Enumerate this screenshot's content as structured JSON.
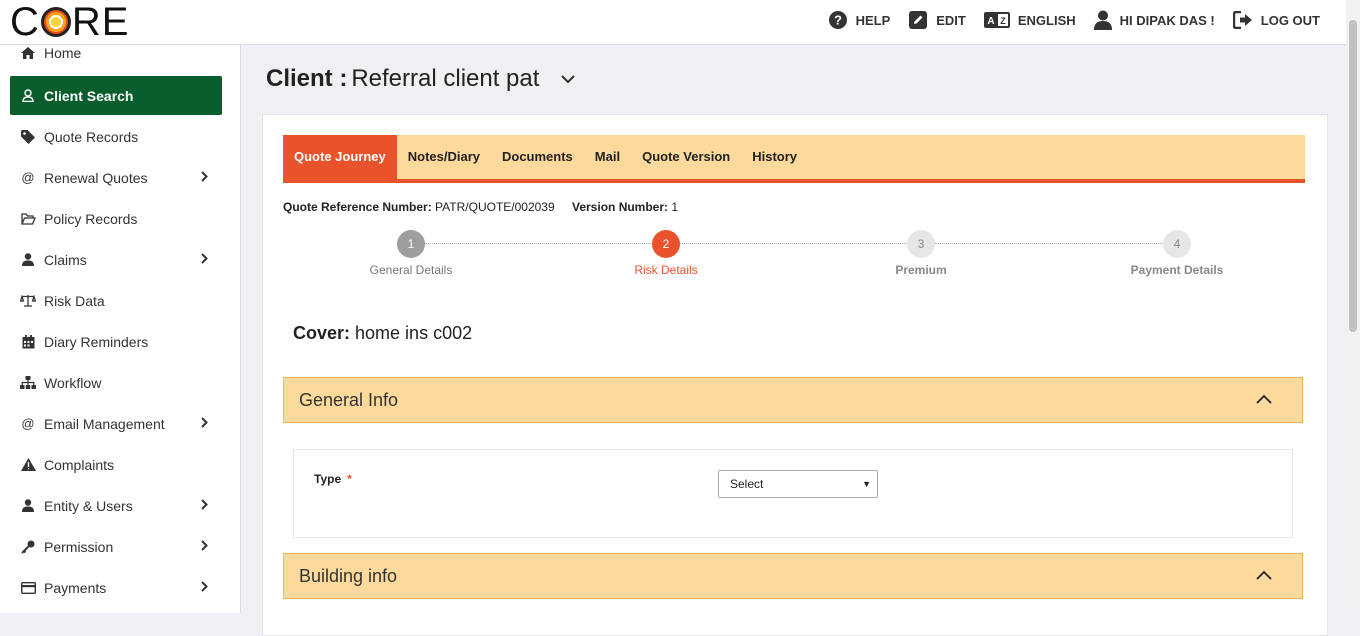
{
  "app": {
    "logo_text_left": "C",
    "logo_text_right": "RE",
    "logo_name": "CORE"
  },
  "topnav": {
    "help": "HELP",
    "edit": "EDIT",
    "language": "ENGLISH",
    "user": "HI DIPAK DAS !",
    "logout": "LOG OUT"
  },
  "sidebar": {
    "items": [
      {
        "label": "Home",
        "icon": "home-icon"
      },
      {
        "label": "Client Search",
        "icon": "user-icon",
        "active": true
      },
      {
        "label": "Quote Records",
        "icon": "tag-icon"
      },
      {
        "label": "Renewal Quotes",
        "icon": "at-icon",
        "has_submenu": true
      },
      {
        "label": "Policy Records",
        "icon": "folder-icon"
      },
      {
        "label": "Claims",
        "icon": "user-icon",
        "has_submenu": true
      },
      {
        "label": "Risk Data",
        "icon": "balance-scale-icon"
      },
      {
        "label": "Diary Reminders",
        "icon": "calendar-icon"
      },
      {
        "label": "Workflow",
        "icon": "sitemap-icon"
      },
      {
        "label": "Email Management",
        "icon": "at-icon",
        "has_submenu": true
      },
      {
        "label": "Complaints",
        "icon": "warning-icon"
      },
      {
        "label": "Entity & Users",
        "icon": "user-icon",
        "has_submenu": true
      },
      {
        "label": "Permission",
        "icon": "key-icon",
        "has_submenu": true
      },
      {
        "label": "Payments",
        "icon": "credit-card-icon",
        "has_submenu": true
      }
    ]
  },
  "header": {
    "client_prefix": "Client :",
    "client_name": "Referral client pat"
  },
  "tabs": [
    {
      "label": "Quote Journey",
      "active": true
    },
    {
      "label": "Notes/Diary"
    },
    {
      "label": "Documents"
    },
    {
      "label": "Mail"
    },
    {
      "label": "Quote Version"
    },
    {
      "label": "History"
    }
  ],
  "quote": {
    "ref_label": "Quote Reference Number:",
    "ref_value": "PATR/QUOTE/002039",
    "version_label": "Version Number:",
    "version_value": "1"
  },
  "steps": [
    {
      "num": "1",
      "label": "General Details",
      "state": "done"
    },
    {
      "num": "2",
      "label": "Risk Details",
      "state": "current"
    },
    {
      "num": "3",
      "label": "Premium",
      "state": "future"
    },
    {
      "num": "4",
      "label": "Payment Details",
      "state": "future"
    }
  ],
  "cover": {
    "label": "Cover:",
    "value": "home ins c002"
  },
  "panels": {
    "general_info": "General Info",
    "building_info": "Building info"
  },
  "form": {
    "type_label": "Type",
    "required_mark": "*",
    "type_value": "Select"
  },
  "colors": {
    "accent": "#e8532b",
    "tab_bg": "#fed99c",
    "sidebar_active": "#075d2b"
  }
}
